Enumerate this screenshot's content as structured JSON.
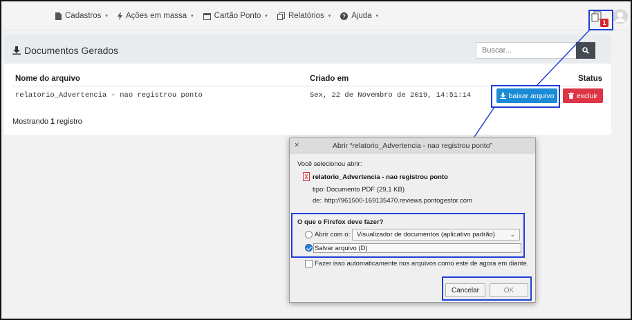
{
  "navbar": {
    "items": [
      {
        "icon": "file-icon",
        "label": "Cadastros",
        "caret": "▾"
      },
      {
        "icon": "bolt-icon",
        "label": "Ações em massa",
        "caret": "▾"
      },
      {
        "icon": "calendar-icon",
        "label": "Cartão Ponto",
        "caret": "▾"
      },
      {
        "icon": "copy-icon",
        "label": "Relatórios",
        "caret": "▾"
      },
      {
        "icon": "question-icon",
        "label": "Ajuda",
        "caret": "▾"
      }
    ],
    "notification_count": "1"
  },
  "card": {
    "title": "Documentos Gerados",
    "search_placeholder": "Buscar...",
    "columns": [
      "Nome do arquivo",
      "Criado em",
      "Status"
    ],
    "rows": [
      {
        "name": "relatorio_Advertencia - nao registrou ponto",
        "created": "Sex, 22 de Novembro de 2019, 14:51:14",
        "download_label": "baixar arquivo",
        "delete_label": "excluir"
      }
    ],
    "showing_prefix": "Mostrando ",
    "showing_count": "1",
    "showing_suffix": " registro"
  },
  "dialog": {
    "title": "Abrir “relatorio_Advertencia - nao registrou ponto”",
    "close": "×",
    "intro": "Você selecionou abrir:",
    "file_name": "relatorio_Advertencia - nao registrou ponto",
    "type_label": "tipo:",
    "type_value": "Documento PDF (29,1 KB)",
    "from_label": "de:",
    "from_value": "http://961500-169135470.reviews.pontogestor.com",
    "question": "O que o Firefox deve fazer?",
    "open_with_label": "Abrir com o:",
    "open_with_value": "Visualizador de documentos (aplicativo padrão)",
    "save_label": "Salvar arquivo (D)",
    "auto_label": "Fazer isso automaticamente nos arquivos como este de agora em diante.",
    "cancel_label": "Cancelar",
    "ok_label": "OK"
  },
  "colors": {
    "highlight": "#1d3fd6",
    "download_button": "#1a8bd6",
    "delete_button": "#dc3545",
    "badge": "#d9262c"
  }
}
